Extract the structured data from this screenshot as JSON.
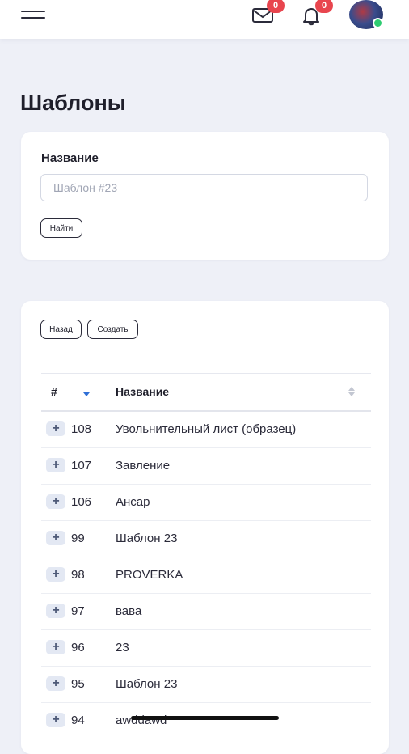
{
  "header": {
    "menu_icon": "hamburger-icon",
    "mail": {
      "icon": "envelope-icon",
      "badge": "0"
    },
    "notifications": {
      "icon": "bell-icon",
      "badge": "0"
    },
    "avatar_status_color": "#2ecc71",
    "badge_color": "#e8454e"
  },
  "page": {
    "title": "Шаблоны"
  },
  "search": {
    "label": "Название",
    "placeholder": "Шаблон #23",
    "value": "",
    "submit_label": "Найти"
  },
  "toolbar": {
    "back_label": "Назад",
    "create_label": "Создать"
  },
  "table": {
    "columns": [
      "#",
      "Название"
    ],
    "sort": {
      "column": "#",
      "direction": "desc",
      "accent": "#2f6fd6"
    },
    "rows": [
      {
        "id": "108",
        "name": "Увольнительный лист (образец)"
      },
      {
        "id": "107",
        "name": "Завление"
      },
      {
        "id": "106",
        "name": "Ансар"
      },
      {
        "id": "99",
        "name": "Шаблон 23"
      },
      {
        "id": "98",
        "name": "PROVERKA"
      },
      {
        "id": "97",
        "name": "вава"
      },
      {
        "id": "96",
        "name": "23"
      },
      {
        "id": "95",
        "name": "Шаблон 23"
      },
      {
        "id": "94",
        "name": "awddawd"
      }
    ]
  }
}
